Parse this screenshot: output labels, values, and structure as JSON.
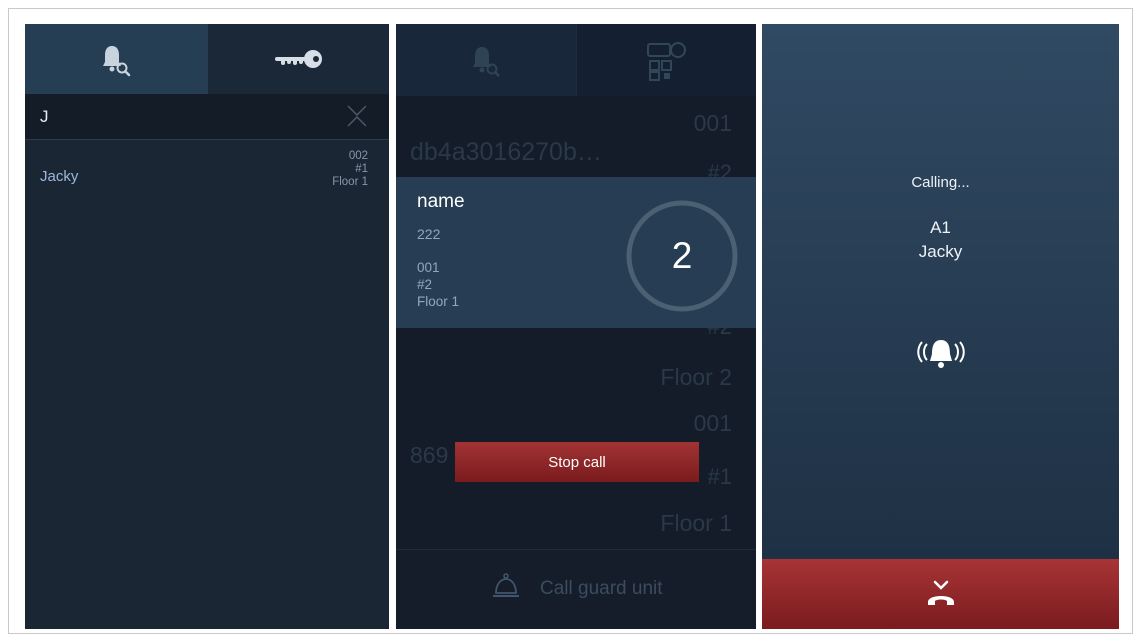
{
  "panel1": {
    "tabs": [
      {
        "icon": "bell-search-icon",
        "active": true
      },
      {
        "icon": "key-icon",
        "active": false
      }
    ],
    "search": {
      "query": "J",
      "clear_icon": "clear-icon"
    },
    "results": [
      {
        "name": "Jacky",
        "code": "002",
        "building": "#1",
        "floor": "Floor 1"
      }
    ]
  },
  "panel2": {
    "tabs": [
      {
        "icon": "bell-search-icon",
        "active": true
      },
      {
        "icon": "key-qr-icon",
        "active": false
      }
    ],
    "background_list": {
      "row1_code": "001",
      "row1_name": "db4a3016270b…",
      "row1_building": "#2",
      "row2_building": "#2",
      "row2_floor": "Floor 2",
      "row3_code": "001",
      "row3_name": "869",
      "row3_building": "#1",
      "row3_floor": "Floor 1"
    },
    "popup": {
      "name": "name",
      "code": "222",
      "unit": "001",
      "building": "#2",
      "floor": "Floor 1",
      "countdown": "2"
    },
    "stop_call_label": "Stop call",
    "guard_label": "Call guard unit",
    "guard_icon": "bell-desk-icon"
  },
  "panel3": {
    "status": "Calling...",
    "target_unit": "A1",
    "target_name": "Jacky",
    "ringing_icon": "ringing-bell-icon",
    "hangup_icon": "hang-up-icon",
    "colors": {
      "hangup_bar": "#a83436",
      "background_top": "#304a63"
    }
  }
}
